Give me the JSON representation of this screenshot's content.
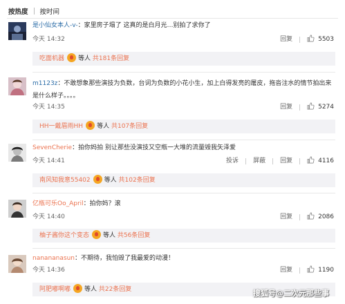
{
  "sort": {
    "by_heat": "按热度",
    "by_time": "按时间"
  },
  "comments": [
    {
      "user": "是小仙女本人-v-",
      "text": "：家里房子塌了 这真的是白月光…别拍了求你了",
      "time": "5月14日 14:32",
      "time_display": "今天 14:32",
      "reply_label": "回复",
      "likes": "5503",
      "reply_user": "吃面机器",
      "reply_mid": "等人",
      "reply_more": "共181条回复"
    },
    {
      "user": "m1123z",
      "text": "：不敢想象那些演技为负数，台词为负数的小花小生，加上白得发亮的屠皮，拖沓注水的情节拍出来是什么样子。。。。",
      "time_display": "今天 14:35",
      "reply_label": "回复",
      "likes": "5274",
      "reply_user": "HH一戴眉雨HH",
      "reply_mid": "等人",
      "reply_more": "共107条回复"
    },
    {
      "user": "SevenCherie",
      "text": "：拍你妈拍 别让那些没演技又空瓶一大堆的流量毁我矢泽爱",
      "time_display": "今天 14:41",
      "report_label": "投诉",
      "block_label": "屏蔽",
      "reply_label": "回复",
      "likes": "4116",
      "reply_user": "南风知我意55402",
      "reply_mid": "等人",
      "reply_more": "共102条回复"
    },
    {
      "user": "亿瓶可乐Oo_April",
      "text": "：拍你妈？滚",
      "time_display": "今天 14:40",
      "reply_label": "回复",
      "likes": "2086",
      "reply_user": "柚子酱你这个变态",
      "reply_mid": "等人",
      "reply_more": "共56条回复"
    },
    {
      "user": "nanananasun",
      "text": "：不期待，我怕毁了我最爱的动漫！",
      "time_display": "今天 14:36",
      "reply_label": "回复",
      "likes": "1190",
      "reply_user": "阿肥嘟啊嘟",
      "reply_mid": "等人",
      "reply_more": "共22条回复"
    }
  ],
  "watermark": "搜狐号@二次元那些事",
  "colors": {
    "username": "#eb7350",
    "reply_bg": "#f2f2f5",
    "divider": "#e8e8e8"
  },
  "icons": {
    "like": "thumbs-up-icon",
    "badge": "fan-badge-icon"
  }
}
